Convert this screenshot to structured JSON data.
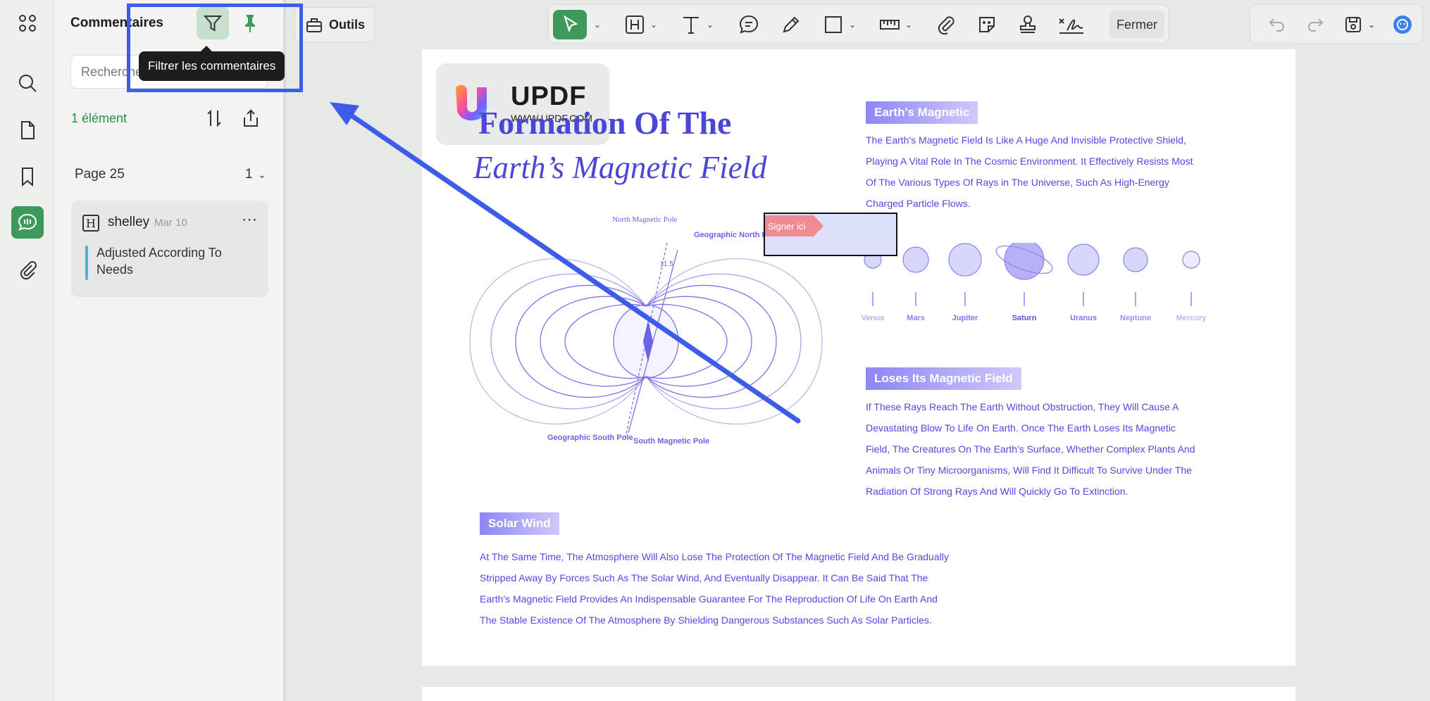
{
  "panel": {
    "title": "Commentaires",
    "search_placeholder": "Rechercher",
    "count": "1 élément",
    "page_label": "Page 25",
    "page_count": "1"
  },
  "tooltip": "Filtrer les commentaires",
  "comment": {
    "user": "shelley",
    "date": "Mar 10",
    "text": "Adjusted According To Needs"
  },
  "toolbar": {
    "outils": "Outils",
    "fermer": "Fermer"
  },
  "document": {
    "logo_name": "UPDF",
    "logo_url": "WWW.UPDF.COM",
    "title_line1": "Formation Of The",
    "title_line2": "Earth’s Magnetic Field",
    "labels": {
      "north_magnetic_pole": "North Magnetic Pole",
      "geographic_north_pole": "Geographic North Pole",
      "geographic_south_pole": "Geographic South Pole",
      "south_magnetic_pole": "South Magnetic Pole",
      "angle": "11.5"
    },
    "planets": [
      "Venus",
      "Mars",
      "Jupiter",
      "Saturn",
      "Uranus",
      "Neptune",
      "Mercury"
    ],
    "sign_label": "Signer ici",
    "sections": [
      {
        "tag": "Earth's Magnetic",
        "lines": [
          "The Earth's Magnetic Field Is Like A Huge And Invisible Protective Shield,",
          "Playing A Vital Role In The Cosmic Environment. It Effectively Resists Most",
          "Of The Various Types Of Rays in The Universe, Such As High-Energy",
          "Charged Particle Flows."
        ]
      },
      {
        "tag": "Loses Its Magnetic Field",
        "lines": [
          "If These Rays Reach The Earth Without Obstruction, They Will Cause A",
          "Devastating Blow To Life On Earth. Once The Earth Loses Its Magnetic",
          "Field, The Creatures On The Earth's Surface, Whether Complex Plants And",
          "Animals Or Tiny Microorganisms, Will Find It Difficult To Survive Under The",
          "Radiation Of Strong Rays And Will Quickly Go To Extinction."
        ]
      },
      {
        "tag": "Solar Wind",
        "lines": [
          "At The Same Time, The Atmosphere Will Also Lose The Protection Of The Magnetic Field And Be Gradually",
          "Stripped Away By Forces Such As The Solar Wind, And Eventually Disappear. It Can Be Said That The",
          "Earth's Magnetic Field Provides An Indispensable Guarantee For The Reproduction Of Life On Earth And",
          "The Stable Existence Of The Atmosphere By Shielding Dangerous Substances Such As Solar Particles."
        ]
      }
    ]
  },
  "colors": {
    "accent_green": "#3e9a5a",
    "highlight_blue": "#3d5ce8",
    "doc_text": "#4f4ae0"
  }
}
